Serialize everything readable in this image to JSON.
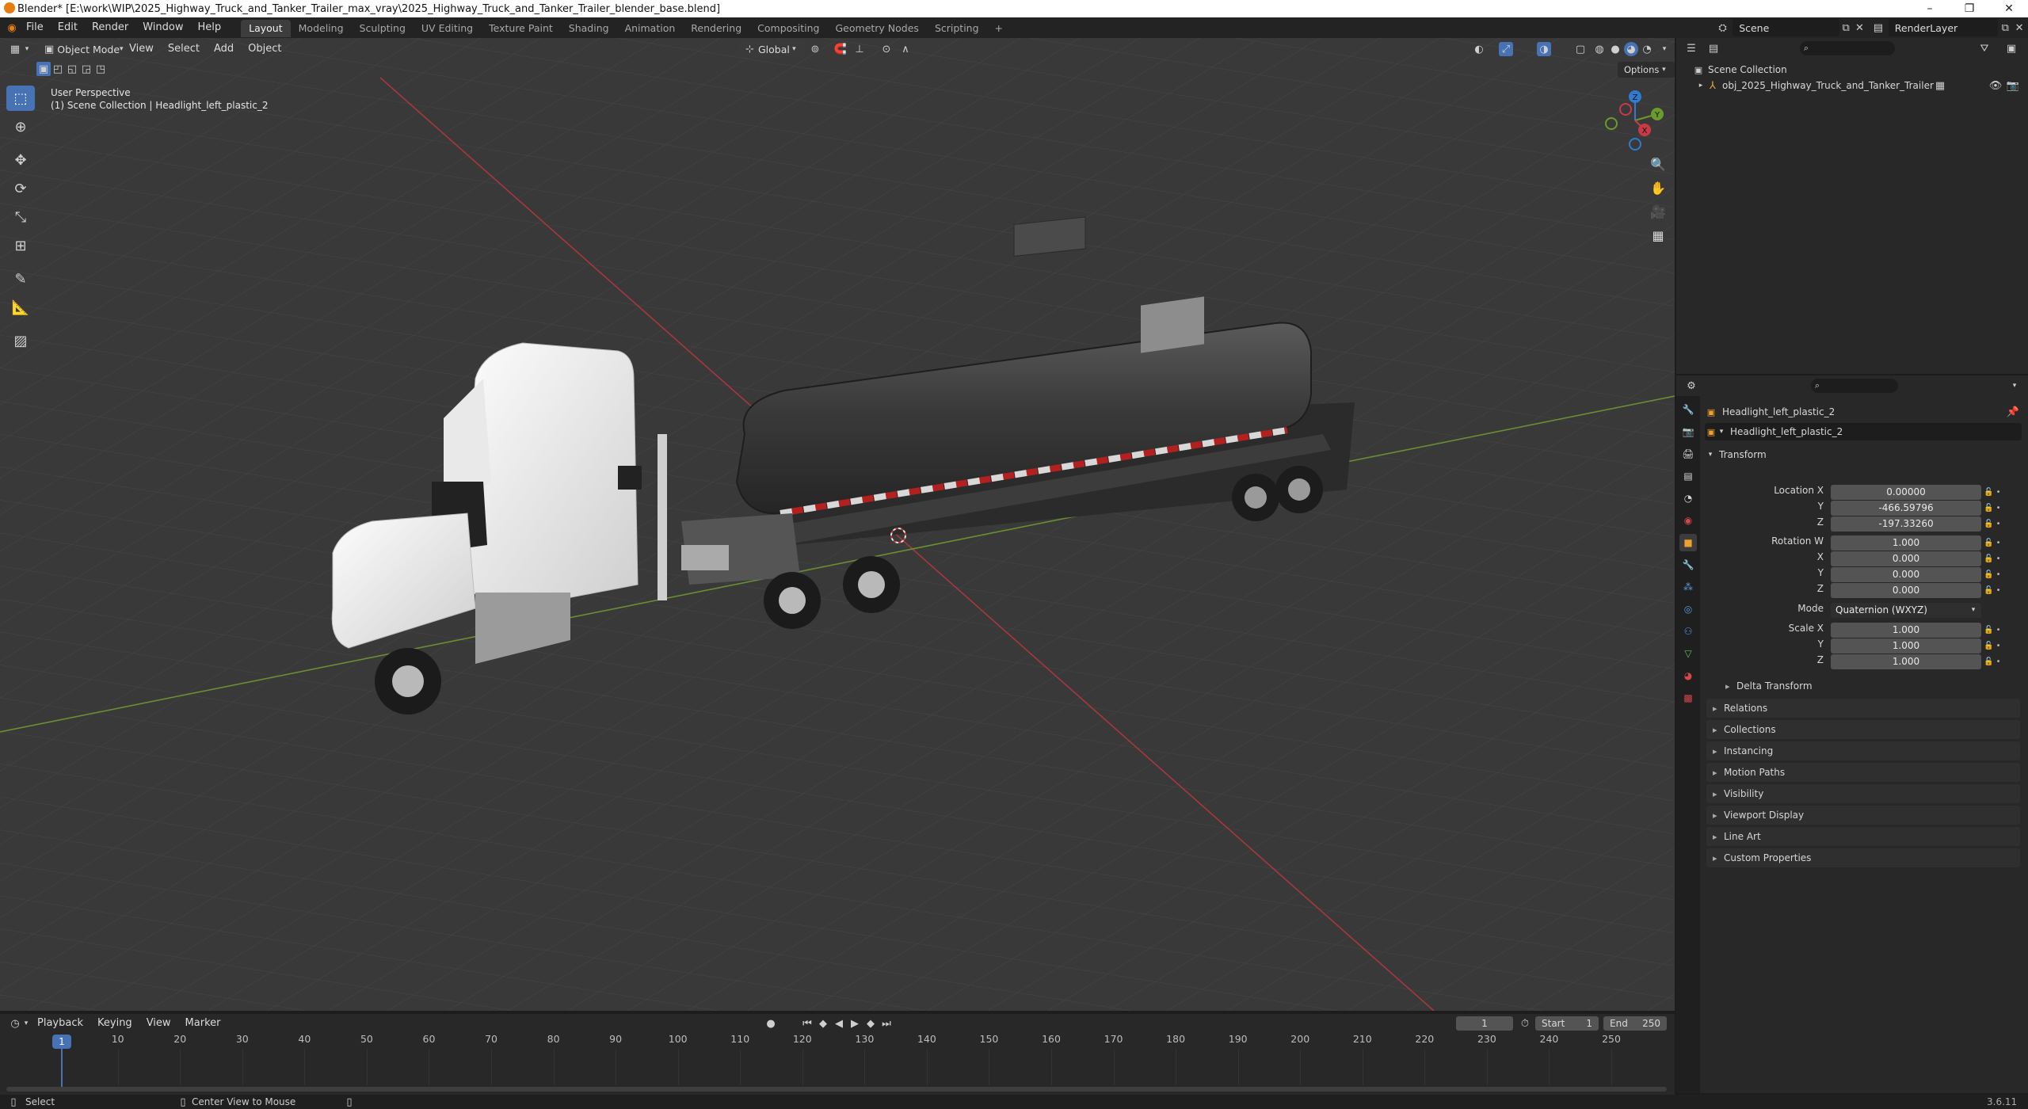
{
  "window": {
    "title": "Blender* [E:\\work\\WIP\\2025_Highway_Truck_and_Tanker_Trailer_max_vray\\2025_Highway_Truck_and_Tanker_Trailer_blender_base.blend]",
    "controls": {
      "minimize": "–",
      "maximize": "❐",
      "close": "✕"
    }
  },
  "menu": [
    "File",
    "Edit",
    "Render",
    "Window",
    "Help"
  ],
  "workspaces": [
    "Layout",
    "Modeling",
    "Sculpting",
    "UV Editing",
    "Texture Paint",
    "Shading",
    "Animation",
    "Rendering",
    "Compositing",
    "Geometry Nodes",
    "Scripting"
  ],
  "active_workspace": "Layout",
  "add_workspace": "+",
  "scene_name": "Scene",
  "view_layer": "RenderLayer",
  "viewport": {
    "mode": "Object Mode",
    "menus": [
      "View",
      "Select",
      "Add",
      "Object"
    ],
    "transform_orientation": "Global",
    "options_label": "Options",
    "overlay_line1": "User Perspective",
    "overlay_line2": "(1) Scene Collection | Headlight_left_plastic_2",
    "gizmo": {
      "x": "X",
      "y": "Y",
      "z": "Z"
    }
  },
  "outliner": {
    "root": "Scene Collection",
    "items": [
      {
        "name": "obj_2025_Highway_Truck_and_Tanker_Trailer"
      }
    ]
  },
  "properties": {
    "object_name": "Headlight_left_plastic_2",
    "data_name": "Headlight_left_plastic_2",
    "transform_label": "Transform",
    "location": {
      "label": "Location X",
      "x": "0.00000",
      "y": "-466.59796",
      "z": "-197.33260"
    },
    "rotation": {
      "label": "Rotation W",
      "w": "1.000",
      "x": "0.000",
      "y": "0.000",
      "z": "0.000"
    },
    "axis_labels": {
      "x": "X",
      "y": "Y",
      "z": "Z"
    },
    "mode_label": "Mode",
    "mode_value": "Quaternion (WXYZ)",
    "scale": {
      "label": "Scale X",
      "x": "1.000",
      "y": "1.000",
      "z": "1.000"
    },
    "delta_transform": "Delta Transform",
    "panels": [
      "Relations",
      "Collections",
      "Instancing",
      "Motion Paths",
      "Visibility",
      "Viewport Display",
      "Line Art",
      "Custom Properties"
    ]
  },
  "timeline": {
    "menus": [
      "Playback",
      "Keying",
      "View",
      "Marker"
    ],
    "current_frame": "1",
    "start_label": "Start",
    "start": "1",
    "end_label": "End",
    "end": "250",
    "ticks": [
      "1",
      "10",
      "20",
      "30",
      "40",
      "50",
      "60",
      "70",
      "80",
      "90",
      "100",
      "110",
      "120",
      "130",
      "140",
      "150",
      "160",
      "170",
      "180",
      "190",
      "200",
      "210",
      "220",
      "230",
      "240",
      "250"
    ]
  },
  "status": {
    "select": "Select",
    "center_view": "Center View to Mouse",
    "version": "3.6.11"
  }
}
